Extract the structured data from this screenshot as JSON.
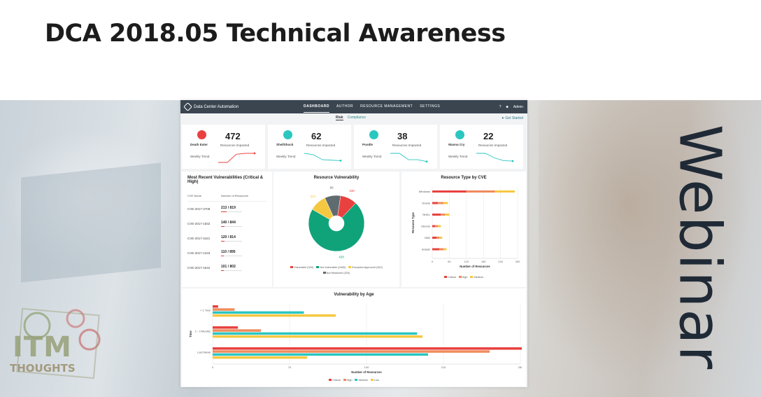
{
  "headline": "DCA 2018.05 Technical Awareness",
  "side_label": "Webinar",
  "logo": {
    "line1": "ITM",
    "line2": "THOUGHTS"
  },
  "colors": {
    "critical": "#e8413f",
    "high": "#f08b5c",
    "medium": "#2cc6c0",
    "low": "#f5c842",
    "dark": "#3a4550"
  },
  "app": {
    "title": "Data Center Automation",
    "nav": [
      "DASHBOARD",
      "AUTHOR",
      "RESOURCE MANAGEMENT",
      "SETTINGS"
    ],
    "help": "?",
    "user": "Admin",
    "subtabs": [
      "Risk",
      "Compliance"
    ],
    "get_started": "Get Started"
  },
  "cards": [
    {
      "name": "Death Eater",
      "count": "472",
      "sub": "Resources Impacted",
      "trend": "Weekly Trend",
      "color": "#e8413f",
      "trend_values": [
        0,
        0,
        0.9,
        1,
        1
      ]
    },
    {
      "name": "ShellShock",
      "count": "62",
      "sub": "Resources Impacted",
      "trend": "Weekly Trend",
      "color": "#2cc6c0",
      "trend_values": [
        1,
        0.85,
        0.3,
        0.25,
        0.2
      ]
    },
    {
      "name": "Poodle",
      "count": "38",
      "sub": "Resources Impacted",
      "trend": "Weekly Trend",
      "color": "#2cc6c0",
      "trend_values": [
        1,
        1,
        0.3,
        0.3,
        0.1
      ]
    },
    {
      "name": "Wanna Cry",
      "count": "22",
      "sub": "Resources Impacted",
      "trend": "Weekly Trend",
      "color": "#2cc6c0",
      "trend_values": [
        1,
        1,
        0.5,
        0.2,
        0.15
      ]
    }
  ],
  "vuln_list": {
    "title": "Most Recent Vulnerabilities (Critical & High)",
    "col1": "CVE Name",
    "col2": "Number of Resources",
    "rows": [
      {
        "cve": "CVE-2017-3708",
        "num": "213 / 819",
        "ratio": 0.26
      },
      {
        "cve": "CVE-2017-1832",
        "num": "140 / 844",
        "ratio": 0.17
      },
      {
        "cve": "CVE-2017-3421",
        "num": "120 / 814",
        "ratio": 0.15
      },
      {
        "cve": "CVE-2017-1233",
        "num": "110 / 895",
        "ratio": 0.12
      },
      {
        "cve": "CVE-2017-1542",
        "num": "101 / 802",
        "ratio": 0.13
      }
    ]
  },
  "chart_data": [
    {
      "type": "pie",
      "title": "Resource Vulnerability",
      "categories": [
        "Vulnerable (340)",
        "Not Vulnerable (2480)",
        "Exception Approved (342)",
        "Not Measured (320)"
      ],
      "values": [
        340,
        2480,
        342,
        320
      ],
      "slice_labels": [
        "340",
        "428",
        "342",
        "96"
      ],
      "colors": [
        "#e8413f",
        "#10a37a",
        "#f5c842",
        "#5f6b6e"
      ]
    },
    {
      "type": "bar",
      "orientation": "horizontal",
      "stacked": true,
      "title": "Resource Type by CVE",
      "xlabel": "Number of Resources",
      "ylabel": "Resource Type",
      "categories": [
        "Windows",
        "Oracle",
        "RHEL",
        "Ubuntu",
        "DB2",
        "Solaris"
      ],
      "xticks": [
        "0",
        "60",
        "120",
        "180",
        "240",
        "300"
      ],
      "xlim": [
        0,
        300
      ],
      "series": [
        {
          "name": "Critical",
          "values": [
            120,
            20,
            30,
            10,
            15,
            25
          ],
          "color": "#e8413f"
        },
        {
          "name": "High",
          "values": [
            100,
            20,
            15,
            10,
            10,
            15
          ],
          "color": "#f08b5c"
        },
        {
          "name": "Medium",
          "values": [
            70,
            15,
            15,
            10,
            10,
            10
          ],
          "color": "#f5c842"
        }
      ]
    },
    {
      "type": "bar",
      "orientation": "horizontal",
      "title": "Vulnerability by Age",
      "xlabel": "Number of Resources",
      "ylabel": "Time",
      "categories": [
        "< 1 Year",
        "1 - 3 Months",
        "Last Week"
      ],
      "xticks": [
        "0",
        "70",
        "140",
        "210",
        "280"
      ],
      "xlim": [
        0,
        280
      ],
      "series": [
        {
          "name": "Critical",
          "values": [
            5,
            23,
            282
          ],
          "color": "#e8413f"
        },
        {
          "name": "High",
          "values": [
            20,
            44,
            252
          ],
          "color": "#f08b5c"
        },
        {
          "name": "Medium",
          "values": [
            83,
            186,
            196
          ],
          "color": "#2cc6c0"
        },
        {
          "name": "Low",
          "values": [
            112,
            191,
            86
          ],
          "color": "#f5c842"
        }
      ]
    }
  ]
}
